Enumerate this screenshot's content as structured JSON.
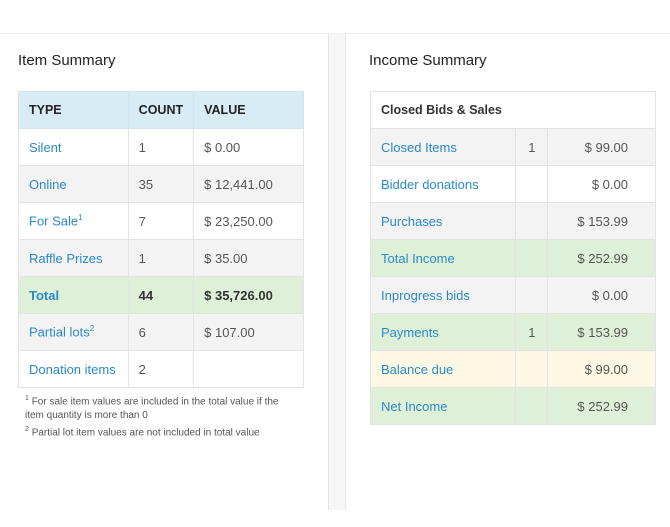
{
  "item_summary": {
    "title": "Item Summary",
    "headers": {
      "type": "TYPE",
      "count": "COUNT",
      "value": "VALUE"
    },
    "rows": [
      {
        "type": "Silent",
        "sup": "",
        "count": "1",
        "value": "$ 0.00"
      },
      {
        "type": "Online",
        "sup": "",
        "count": "35",
        "value": "$ 12,441.00"
      },
      {
        "type": "For Sale",
        "sup": "1",
        "count": "7",
        "value": "$ 23,250.00"
      },
      {
        "type": "Raffle Prizes",
        "sup": "",
        "count": "1",
        "value": "$ 35.00"
      },
      {
        "type": "Total",
        "sup": "",
        "count": "44",
        "value": "$ 35,726.00"
      },
      {
        "type": "Partial lots",
        "sup": "2",
        "count": "6",
        "value": "$ 107.00"
      },
      {
        "type": "Donation items",
        "sup": "",
        "count": "2",
        "value": ""
      }
    ],
    "footnotes": [
      {
        "mark": "1",
        "text": "For sale item values are included in the total value if the item quantity is more than 0"
      },
      {
        "mark": "2",
        "text": "Partial lot item values are not included in total value"
      }
    ]
  },
  "income_summary": {
    "title": "Income Summary",
    "header": "Closed Bids & Sales",
    "rows": [
      {
        "label": "Closed Items",
        "count": "1",
        "amount": "$ 99.00"
      },
      {
        "label": "Bidder donations",
        "count": "",
        "amount": "$ 0.00"
      },
      {
        "label": "Purchases",
        "count": "",
        "amount": "$ 153.99"
      },
      {
        "label": "Total Income",
        "count": "",
        "amount": "$ 252.99"
      },
      {
        "label": "Inprogress bids",
        "count": "",
        "amount": "$ 0.00"
      },
      {
        "label": "Payments",
        "count": "1",
        "amount": "$ 153.99"
      },
      {
        "label": "Balance due",
        "count": "",
        "amount": "$ 99.00"
      },
      {
        "label": "Net Income",
        "count": "",
        "amount": "$ 252.99"
      }
    ]
  },
  "colors": {
    "header_blue": "#d8ecf6",
    "total_green": "#def0d8",
    "balance_yellow": "#fcf8e3",
    "link_blue": "#2a8ac8"
  }
}
